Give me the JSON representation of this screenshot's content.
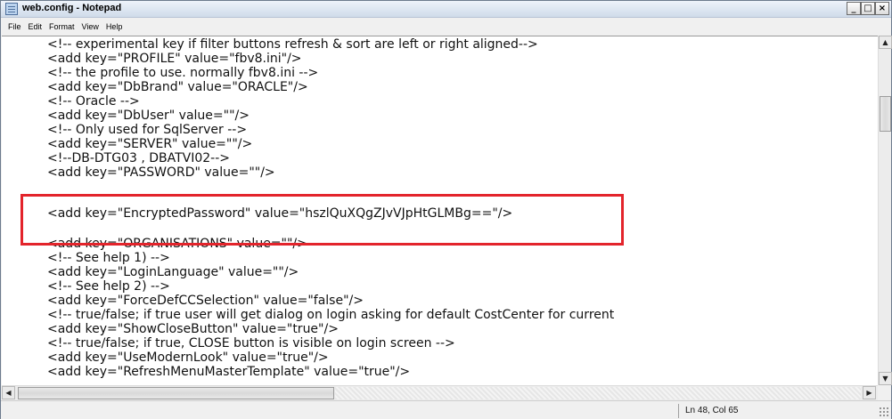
{
  "window": {
    "title": "web.config - Notepad",
    "icon": "notepad-icon",
    "controls": {
      "minimize": "_",
      "maximize": "□",
      "close": "×"
    }
  },
  "menu": [
    "File",
    "Edit",
    "Format",
    "View",
    "Help"
  ],
  "editor": {
    "lines": [
      "<!-- experimental key if filter buttons refresh & sort are left or right aligned-->",
      "<add key=\"PROFILE\" value=\"fbv8.ini\"/>",
      "<!-- the profile to use. normally fbv8.ini -->",
      "<add key=\"DbBrand\" value=\"ORACLE\"/>",
      "<!-- Oracle -->",
      "<add key=\"DbUser\" value=\"\"/>",
      "<!-- Only used for SqlServer -->",
      "<add key=\"SERVER\" value=\"\"/>",
      "<!--DB-DTG03 , DBATVI02-->",
      "<add key=\"PASSWORD\" value=\"\"/>",
      "<add key=\"EncryptedPassword\" value=\"hszlQuXQgZJvVJpHtGLMBg==\"/>",
      "<add key=\"ORGANISATIONS\" value=\"\"/>",
      "<!-- See help 1) -->",
      "<add key=\"LoginLanguage\" value=\"\"/>",
      "<!-- See help 2) -->",
      "<add key=\"ForceDefCCSelection\" value=\"false\"/>",
      "<!-- true/false; if true user will get dialog on login asking for default CostCenter for current",
      "<add key=\"ShowCloseButton\" value=\"true\"/>",
      "<!-- true/false; if true, CLOSE button is visible on login screen -->",
      "<add key=\"UseModernLook\" value=\"true\"/>",
      "<add key=\"RefreshMenuMasterTemplate\" value=\"true\"/>"
    ],
    "highlight_color": "#e3242b"
  },
  "scrollbars": {
    "up_arrow": "▲",
    "down_arrow": "▼",
    "left_arrow": "◀",
    "right_arrow": "▶"
  },
  "status": {
    "position": "Ln 48, Col 65"
  }
}
